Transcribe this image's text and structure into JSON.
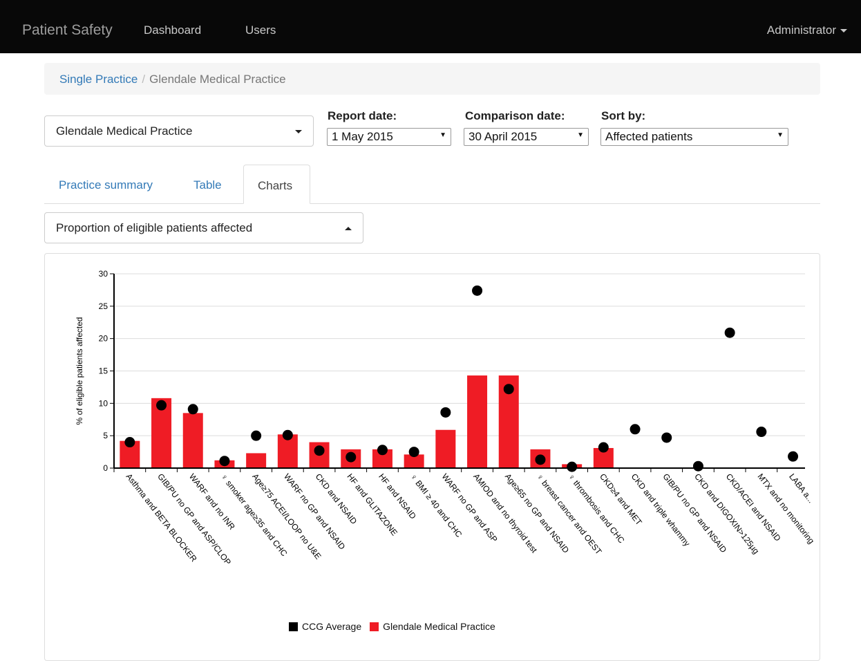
{
  "navbar": {
    "brand": "Patient Safety",
    "links": [
      "Dashboard",
      "Users"
    ],
    "user_menu": "Administrator"
  },
  "breadcrumb": {
    "parent": "Single Practice",
    "separator": "/",
    "current": "Glendale Medical Practice"
  },
  "filters": {
    "practice": "Glendale Medical Practice",
    "report_date_label": "Report date:",
    "report_date_value": "1 May 2015",
    "comparison_date_label": "Comparison date:",
    "comparison_date_value": "30 April 2015",
    "sort_label": "Sort by:",
    "sort_value": "Affected patients"
  },
  "tabs": [
    {
      "label": "Practice summary",
      "active": false
    },
    {
      "label": "Table",
      "active": false
    },
    {
      "label": "Charts",
      "active": true
    }
  ],
  "chart_select": "Proportion of eligible patients affected",
  "colors": {
    "practice_bar": "#ef1c25",
    "ccg_dot": "#000000",
    "navbar": "#080808",
    "link": "#337ab7"
  },
  "chart_data": {
    "type": "bar",
    "ylabel": "% of eligible patients affected",
    "ylim": [
      0,
      30
    ],
    "yticks": [
      0,
      5,
      10,
      15,
      20,
      25,
      30
    ],
    "grid": true,
    "legend_position": "bottom",
    "categories": [
      "Asthma and BETA BLOCKER",
      "GIB/PU no GP and ASP/CLOP",
      "WARF and no INR",
      "♀ smoker age≥35 and CHC",
      "Age≥75 ACEI/LOOP no U&E",
      "WARF no GP and NSAID",
      "CKD and NSAID",
      "HF and GLITAZONE",
      "HF and NSAID",
      "♀ BMI ≥ 40 and CHC",
      "WARF no GP and ASP",
      "AMIOD and no thyroid test",
      "Age≥65 no GP and NSAID",
      "♀ breast cancer and OEST",
      "♀ thrombosis and CHC",
      "CKD≥4 and MET",
      "CKD and triple whammy",
      "GIB/PU no GP and NSAID",
      "CKD and DIGOXIN>125µg",
      "CKD/ACEI and NSAID",
      "MTX and no monitoring",
      "LABA a..."
    ],
    "series": [
      {
        "name": "CCG Average",
        "display": "dot",
        "values": [
          4.0,
          9.7,
          9.1,
          1.1,
          5.0,
          5.1,
          2.7,
          1.7,
          2.8,
          2.5,
          8.6,
          27.4,
          12.2,
          1.3,
          0.2,
          3.2,
          6.0,
          4.7,
          0.3,
          20.9,
          5.6,
          1.8
        ]
      },
      {
        "name": "Glendale Medical Practice",
        "display": "bar",
        "values": [
          4.2,
          10.8,
          8.5,
          1.2,
          2.3,
          5.2,
          4.0,
          2.9,
          2.9,
          2.1,
          5.9,
          14.3,
          14.3,
          2.9,
          0.6,
          3.1,
          0,
          0,
          0,
          0,
          0,
          0
        ]
      }
    ]
  }
}
